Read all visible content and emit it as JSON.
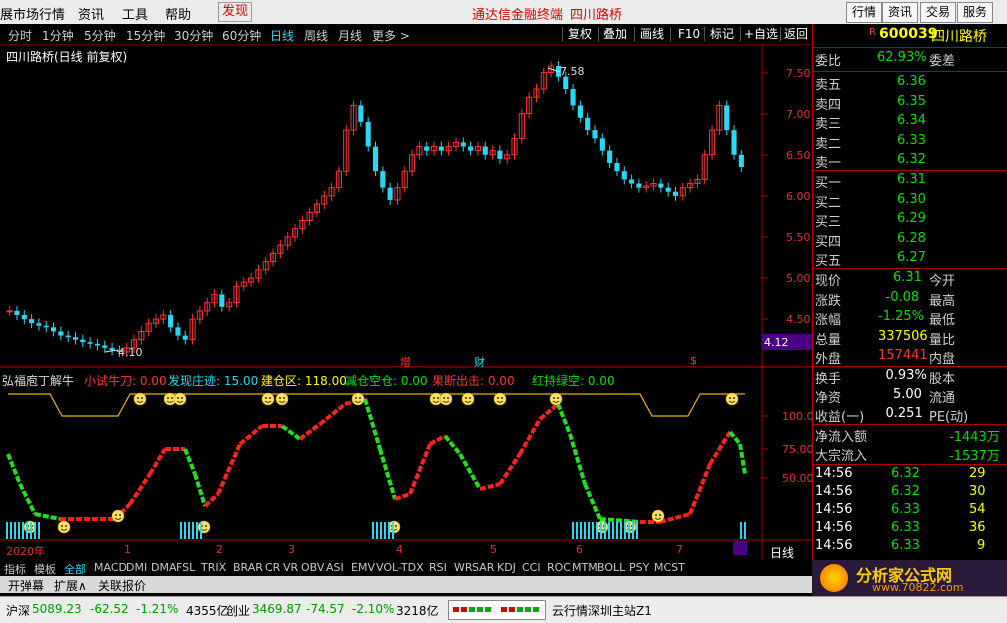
{
  "menu": {
    "items": [
      "展市场行情",
      "资讯",
      "工具",
      "帮助"
    ],
    "highlight": "发现",
    "center_title": "通达信金融终端",
    "center_stock": "四川路桥",
    "right_buttons": [
      "行情",
      "资讯",
      "交易",
      "服务"
    ]
  },
  "periods": [
    "分时",
    "1分钟",
    "5分钟",
    "15分钟",
    "30分钟",
    "60分钟",
    "日线",
    "周线",
    "月线",
    "更多 >"
  ],
  "active_period": "日线",
  "toolbar": [
    "复权",
    "叠加",
    "画线",
    "F10",
    "标记",
    "+自选",
    "返回"
  ],
  "chart": {
    "title": "四川路桥(日线 前复权)",
    "high_label": "7.58",
    "low_label": "4.10",
    "price_ticks": [
      "7.50",
      "7.00",
      "6.50",
      "6.00",
      "5.50",
      "5.00",
      "4.50"
    ],
    "current_price_box": "4.12",
    "markers": [
      "增",
      "财",
      "$"
    ],
    "indicator_title": "弘福庖丁解牛",
    "indicator_params": [
      {
        "label": "小试牛刀: 0.00",
        "color": "#ff3333"
      },
      {
        "label": "发现庄迹: 15.00",
        "color": "#29d8f4"
      },
      {
        "label": "建仓区: 118.00",
        "color": "#ffff00"
      },
      {
        "label": "减仓空仓: 0.00",
        "color": "#00e000"
      },
      {
        "label": "果断出击: 0.00",
        "color": "#ff3333"
      },
      {
        "label": "红持绿空: 0.00",
        "color": "#00e000"
      }
    ],
    "ind_ticks": [
      "100.0",
      "75.00",
      "50.00"
    ],
    "date_labels": [
      "2020年",
      "1",
      "2",
      "3",
      "4",
      "5",
      "6",
      "7"
    ],
    "period_label": "日线"
  },
  "chart_data": {
    "type": "candlestick",
    "title": "四川路桥(日线 前复权)",
    "ylim": [
      4.1,
      7.58
    ],
    "series": [
      {
        "name": "四川路桥",
        "values": [
          4.6,
          4.55,
          4.5,
          4.45,
          4.42,
          4.4,
          4.35,
          4.3,
          4.28,
          4.25,
          4.22,
          4.2,
          4.18,
          4.15,
          4.12,
          4.1,
          4.15,
          4.25,
          4.35,
          4.45,
          4.5,
          4.55,
          4.4,
          4.3,
          4.25,
          4.5,
          4.6,
          4.7,
          4.8,
          4.65,
          4.7,
          4.9,
          4.95,
          5.0,
          5.1,
          5.2,
          5.3,
          5.4,
          5.5,
          5.6,
          5.7,
          5.8,
          5.9,
          6.0,
          6.1,
          6.3,
          6.8,
          7.1,
          6.9,
          6.6,
          6.3,
          6.1,
          5.95,
          6.1,
          6.3,
          6.5,
          6.6,
          6.55,
          6.6,
          6.55,
          6.6,
          6.65,
          6.6,
          6.55,
          6.6,
          6.5,
          6.55,
          6.45,
          6.5,
          6.7,
          7.0,
          7.2,
          7.3,
          7.5,
          7.58,
          7.45,
          7.3,
          7.1,
          6.95,
          6.8,
          6.7,
          6.55,
          6.4,
          6.3,
          6.2,
          6.15,
          6.1,
          6.12,
          6.15,
          6.1,
          6.05,
          6.0,
          6.1,
          6.15,
          6.2,
          6.5,
          6.8,
          7.1,
          6.8,
          6.5,
          6.35
        ]
      }
    ]
  },
  "quote": {
    "code": "600039",
    "name": "四川路桥",
    "weibi_label": "委比",
    "weibi_value": "62.93%",
    "weicha_label": "委差",
    "asks": [
      {
        "label": "卖五",
        "price": "6.36"
      },
      {
        "label": "卖四",
        "price": "6.35"
      },
      {
        "label": "卖三",
        "price": "6.34"
      },
      {
        "label": "卖二",
        "price": "6.33"
      },
      {
        "label": "卖一",
        "price": "6.32"
      }
    ],
    "bids": [
      {
        "label": "买一",
        "price": "6.31"
      },
      {
        "label": "买二",
        "price": "6.30"
      },
      {
        "label": "买三",
        "price": "6.29"
      },
      {
        "label": "买四",
        "price": "6.28"
      },
      {
        "label": "买五",
        "price": "6.27"
      }
    ],
    "stats": [
      {
        "label": "现价",
        "value": "6.31",
        "label2": "今开",
        "vcolor": "g"
      },
      {
        "label": "涨跌",
        "value": "-0.08",
        "label2": "最高",
        "vcolor": "g"
      },
      {
        "label": "涨幅",
        "value": "-1.25%",
        "label2": "最低",
        "vcolor": "g"
      },
      {
        "label": "总量",
        "value": "337506",
        "label2": "量比",
        "vcolor": "y"
      },
      {
        "label": "外盘",
        "value": "157441",
        "label2": "内盘",
        "vcolor": "r"
      }
    ],
    "turnover": [
      {
        "label": "换手",
        "value": "0.93%",
        "label2": "股本"
      },
      {
        "label": "净资",
        "value": "5.00",
        "label2": "流通"
      },
      {
        "label": "收益(一)",
        "value": "0.251",
        "label2": "PE(动)"
      }
    ],
    "flows": [
      {
        "label": "净流入额",
        "value": "-1443万"
      },
      {
        "label": "大宗流入",
        "value": "-1537万"
      }
    ],
    "ticks": [
      {
        "time": "14:56",
        "price": "6.32",
        "vol": "29"
      },
      {
        "time": "14:56",
        "price": "6.32",
        "vol": "30"
      },
      {
        "time": "14:56",
        "price": "6.33",
        "vol": "54"
      },
      {
        "time": "14:56",
        "price": "6.33",
        "vol": "36"
      },
      {
        "time": "14:56",
        "price": "6.33",
        "vol": "9"
      }
    ]
  },
  "tabs": [
    "指标",
    "模板",
    "全部",
    "MACD",
    "DMI",
    "DMA",
    "FSL",
    "TRIX",
    "BRAR",
    "CR",
    "VR",
    "OBV",
    "ASI",
    "EMV",
    "VOL-TDX",
    "RSI",
    "WR",
    "SAR",
    "KDJ",
    "CCI",
    "ROC",
    "MTM",
    "BOLL",
    "PSY",
    "MCST"
  ],
  "subtabs": [
    "开弹幕",
    "扩展∧",
    "关联报价"
  ],
  "status": {
    "sh_label": "沪深",
    "sh_value": "5089.23",
    "sh_change": "-62.52",
    "sh_pct": "-1.21%",
    "sh_amount": "4355亿",
    "cy_label": "创业",
    "cy_value": "3469.87",
    "cy_change": "-74.57",
    "cy_pct": "-2.10%",
    "cy_amount": "3218亿",
    "server": "云行情深圳主站Z1"
  },
  "logo": {
    "text": "分析家公式网",
    "url": "www.70822.com"
  }
}
